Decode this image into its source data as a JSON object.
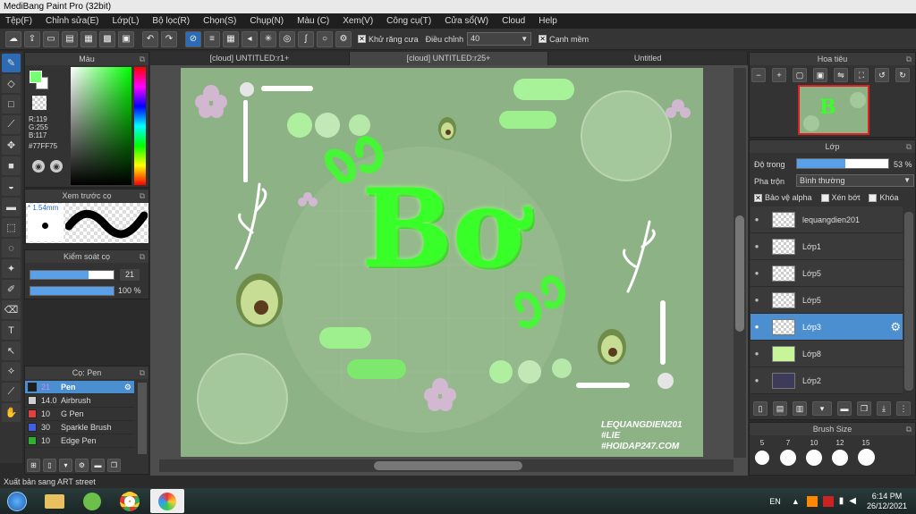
{
  "window": {
    "title": "MediBang Paint Pro (32bit)"
  },
  "menu": [
    "Tệp(F)",
    "Chỉnh sửa(E)",
    "Lớp(L)",
    "Bộ lọc(R)",
    "Chọn(S)",
    "Chụp(N)",
    "Màu (C)",
    "Xem(V)",
    "Công cụ(T)",
    "Cửa sổ(W)",
    "Cloud",
    "Help"
  ],
  "toolbar": {
    "antialias": "Khử răng cưa",
    "adjust": "Điều chỉnh",
    "adjust_value": "40",
    "sharp": "Cạnh mềm"
  },
  "color_panel": {
    "title": "Màu",
    "r": "R:119",
    "g": "G:255",
    "b": "B:117",
    "hex": "#77FF75",
    "fg": "#77ff75",
    "bg": "#ffffff"
  },
  "brush_preview": {
    "title": "Xem trước cọ",
    "size": "* 1.54mm"
  },
  "control": {
    "title": "Kiểm soát cọ",
    "size": "21",
    "opacity": "100 %"
  },
  "brush_panel": {
    "title": "Cọ: Pen",
    "items": [
      {
        "size": "21",
        "name": "Pen",
        "color": "#1e1e1e"
      },
      {
        "size": "14.0",
        "name": "Airbrush",
        "color": "#cfcfcf"
      },
      {
        "size": "10",
        "name": "G Pen",
        "color": "#e04040"
      },
      {
        "size": "30",
        "name": "Sparkle Brush",
        "color": "#4060e0"
      },
      {
        "size": "10",
        "name": "Edge Pen",
        "color": "#30b030"
      }
    ]
  },
  "tabs": [
    "[cloud] UNTITLED:r1+",
    "[cloud] UNTITLED:r25+",
    "Untitled"
  ],
  "artwork": {
    "main_text": "Bơ",
    "watermark1": "LEQUANGDIEN201",
    "watermark2": "#LIE",
    "watermark3": "#HOIDAP247.COM"
  },
  "navigator": {
    "title": "Hoa tiêu"
  },
  "layers": {
    "title": "Lớp",
    "opacity_label": "Độ trong",
    "opacity_value": "53 %",
    "opacity": 0.53,
    "blend_label": "Pha trộn",
    "blend_value": "Bình thường",
    "protect_alpha": "Bảo vệ alpha",
    "clip": "Xén bớt",
    "lock": "Khóa",
    "items": [
      {
        "name": "lequangdien201"
      },
      {
        "name": "Lớp1"
      },
      {
        "name": "Lớp5"
      },
      {
        "name": "Lớp5"
      },
      {
        "name": "Lớp3"
      },
      {
        "name": "Lớp8"
      },
      {
        "name": "Lớp2"
      }
    ]
  },
  "brush_size": {
    "title": "Brush Size",
    "sizes": [
      "5",
      "7",
      "10",
      "12",
      "15"
    ]
  },
  "status": "Xuất bản sang ART street",
  "tray": {
    "lang": "EN",
    "time": "6:14 PM",
    "date": "26/12/2021"
  }
}
